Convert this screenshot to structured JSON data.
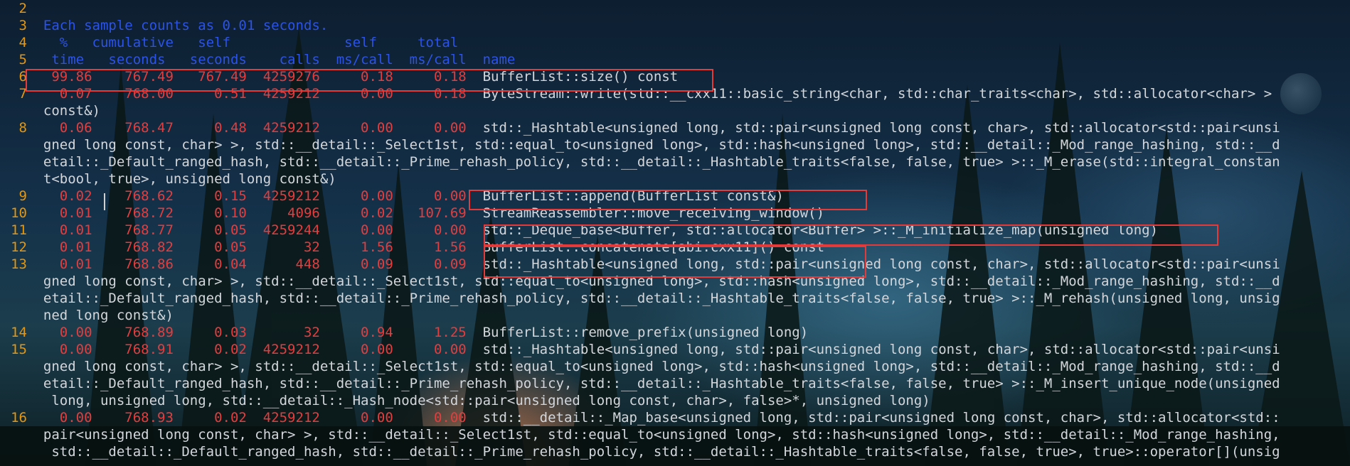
{
  "colors": {
    "line_number": "#e8960a",
    "header": "#2c53e6",
    "numbers": "#e53d3d",
    "function_text": "#d3d7dc",
    "highlight_box": "#e53a3a"
  },
  "lines": [
    {
      "n": "2",
      "t": ""
    },
    {
      "n": "3",
      "t": "Each sample counts as 0.01 seconds."
    },
    {
      "n": "4",
      "t": "  %   cumulative   self              self     total"
    },
    {
      "n": "5",
      "t": " time   seconds   seconds    calls  ms/call  ms/call  name"
    },
    {
      "n": "6",
      "nums": " 99.86    767.49   767.49  4259276     0.18     0.18  ",
      "fn": "BufferList::size() const"
    },
    {
      "n": "7",
      "nums": "  0.07    768.00     0.51  4259212     0.00     0.18  ",
      "fn": "ByteStream::write(std::__cxx11::basic_string<char, std::char_traits<char>, std::allocator<char> >"
    },
    {
      "n": "",
      "t": "const&)"
    },
    {
      "n": "8",
      "nums": "  0.06    768.47     0.48  4259212     0.00     0.00  ",
      "fn": "std::_Hashtable<unsigned long, std::pair<unsigned long const, char>, std::allocator<std::pair<unsi"
    },
    {
      "n": "",
      "t": "gned long const, char> >, std::__detail::_Select1st, std::equal_to<unsigned long>, std::hash<unsigned long>, std::__detail::_Mod_range_hashing, std::__d"
    },
    {
      "n": "",
      "t": "etail::_Default_ranged_hash, std::__detail::_Prime_rehash_policy, std::__detail::_Hashtable_traits<false, false, true> >::_M_erase(std::integral_constan"
    },
    {
      "n": "",
      "t": "t<bool, true>, unsigned long const&)"
    },
    {
      "n": "9",
      "nums": "  0.02    768.62     0.15  4259212     0.00     0.00  ",
      "fn": "BufferList::append(BufferList const&)"
    },
    {
      "n": "10",
      "nums": "  0.01    768.72     0.10     4096     0.02   107.69  ",
      "fn": "StreamReassembler::move_receiving_window()"
    },
    {
      "n": "11",
      "nums": "  0.01    768.77     0.05  4259244     0.00     0.00  ",
      "fn": "std::_Deque_base<Buffer, std::allocator<Buffer> >::_M_initialize_map(unsigned long)"
    },
    {
      "n": "12",
      "nums": "  0.01    768.82     0.05       32     1.56     1.56  ",
      "fn": "BufferList::concatenate[abi:cxx11]() const"
    },
    {
      "n": "13",
      "nums": "  0.01    768.86     0.04      448     0.09     0.09  ",
      "fn": "std::_Hashtable<unsigned long, std::pair<unsigned long const, char>, std::allocator<std::pair<unsi"
    },
    {
      "n": "",
      "t": "gned long const, char> >, std::__detail::_Select1st, std::equal_to<unsigned long>, std::hash<unsigned long>, std::__detail::_Mod_range_hashing, std::__d"
    },
    {
      "n": "",
      "t": "etail::_Default_ranged_hash, std::__detail::_Prime_rehash_policy, std::__detail::_Hashtable_traits<false, false, true> >::_M_rehash(unsigned long, unsig"
    },
    {
      "n": "",
      "t": "ned long const&)"
    },
    {
      "n": "14",
      "nums": "  0.00    768.89     0.03       32     0.94     1.25  ",
      "fn": "BufferList::remove_prefix(unsigned long)"
    },
    {
      "n": "15",
      "nums": "  0.00    768.91     0.02  4259212     0.00     0.00  ",
      "fn": "std::_Hashtable<unsigned long, std::pair<unsigned long const, char>, std::allocator<std::pair<unsi"
    },
    {
      "n": "",
      "t": "gned long const, char> >, std::__detail::_Select1st, std::equal_to<unsigned long>, std::hash<unsigned long>, std::__detail::_Mod_range_hashing, std::__d"
    },
    {
      "n": "",
      "t": "etail::_Default_ranged_hash, std::__detail::_Prime_rehash_policy, std::__detail::_Hashtable_traits<false, false, true> >::_M_insert_unique_node(unsigned"
    },
    {
      "n": "",
      "t": " long, unsigned long, std::__detail::_Hash_node<std::pair<unsigned long const, char>, false>*, unsigned long)"
    },
    {
      "n": "16",
      "nums": "  0.00    768.93     0.02  4259212     0.00     0.00  ",
      "fn": "std::__detail::_Map_base<unsigned long, std::pair<unsigned long const, char>, std::allocator<std::"
    },
    {
      "n": "",
      "t": "pair<unsigned long const, char> >, std::__detail::_Select1st, std::equal_to<unsigned long>, std::hash<unsigned long>, std::__detail::_Mod_range_hashing,"
    },
    {
      "n": "",
      "t": " std::__detail::_Default_ranged_hash, std::__detail::_Prime_rehash_policy, std::__detail::_Hashtable_traits<false, false, true>, true>::operator[](unsig"
    }
  ]
}
